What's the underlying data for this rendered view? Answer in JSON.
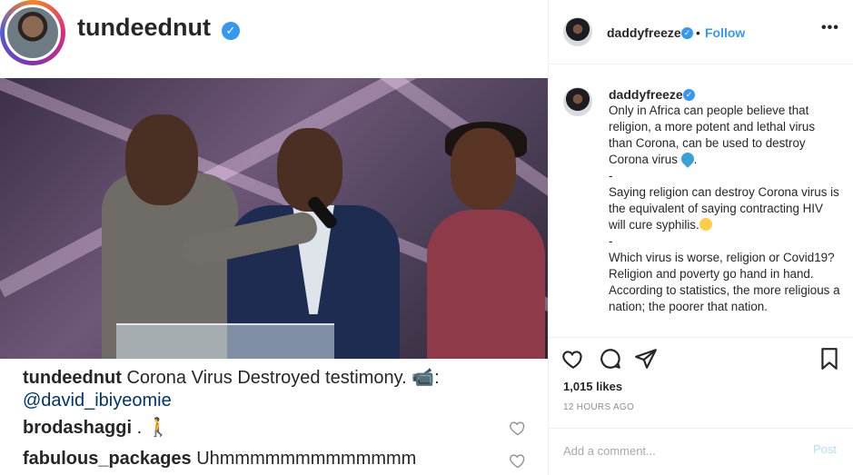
{
  "left": {
    "username": "tundeednut",
    "caption": {
      "username": "tundeednut",
      "text": "Corona Virus Destroyed testimony. 📹:",
      "mention": "@david_ibiyeomie"
    },
    "comments": [
      {
        "username": "brodashaggi",
        "text": ". 🚶"
      },
      {
        "username": "fabulous_packages",
        "text": "Uhmmmmmmmmmmmmm"
      }
    ]
  },
  "right": {
    "header": {
      "username": "daddyfreeze",
      "follow_label": "Follow",
      "dot": "•",
      "more_label": "•••"
    },
    "post": {
      "username": "daddyfreeze",
      "p1": "Only in Africa can people believe that religion, a more potent and lethal virus than Corona, can be used to destroy Corona virus",
      "p1_end": ".",
      "sep1": "-",
      "p2": "Saying religion can destroy Corona virus is the equivalent of saying contracting HIV will cure syphilis.",
      "sep2": "-",
      "p3": "Which virus is worse, religion or Covid19? Religion and poverty go hand in hand. According to statistics, the more religious a nation; the poorer that nation."
    },
    "likes": "1,015 likes",
    "time": "12 HOURS AGO",
    "comment_placeholder": "Add a comment...",
    "post_label": "Post"
  },
  "colors": {
    "accent": "#3897f0",
    "text": "#262626",
    "muted": "#8e8e8e",
    "border": "#efefef"
  },
  "icons": [
    "verified-icon",
    "heart-icon",
    "comment-icon",
    "share-icon",
    "bookmark-icon",
    "more-icon"
  ]
}
